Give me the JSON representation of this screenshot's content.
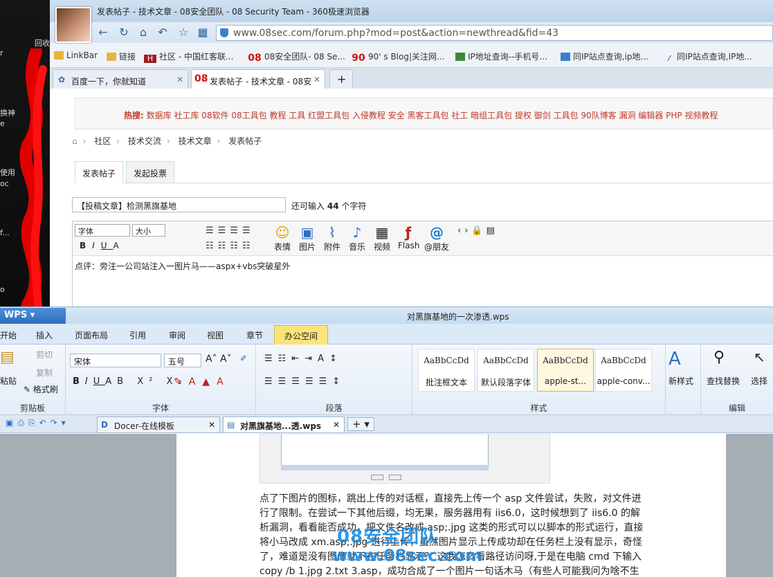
{
  "desktop": {
    "labels": [
      "回收",
      "r",
      "换神",
      "e",
      "使用",
      "oc",
      "f...",
      "o"
    ]
  },
  "browser": {
    "window_title": "发表帖子 - 技术文章 - 08安全团队 - 08 Security Team - 360极速浏览器",
    "url": "www.08sec.com/forum.php?mod=post&action=newthread&fid=43",
    "bookmarks": [
      "LinkBar",
      "链接",
      "社区 - 中国红客联...",
      "08安全团队- 08 Se...",
      "90' s Blog|关注网...",
      "IP地址查询--手机号...",
      "同IP站点查询,ip地...",
      "同IP站点查询,IP地..."
    ],
    "tabs": [
      {
        "label": "百度一下，你就知道"
      },
      {
        "label": "发表帖子 - 技术文章 - 08安"
      }
    ],
    "new_tab": "+",
    "hot_label": "热搜:",
    "hot_items": "数据库  社工库  08软件  08工具包  教程  工具  红盟工具包  入侵教程  安全  黑客工具包  社工  暗组工具包  提权  御剑  工具包  90队博客  漏洞  编辑器  PHP  视频教程",
    "breadcrumb": [
      "社区",
      "技术交流",
      "技术文章",
      "发表帖子"
    ],
    "post_tabs": [
      "发表帖子",
      "发起投票"
    ],
    "subject": "【投稿文章】检测黑旗基地",
    "count_prefix": "还可输入",
    "count_value": "44",
    "count_suffix": "个字符",
    "font_select": "字体",
    "size_select": "大小",
    "editor_icons": [
      "表情",
      "图片",
      "附件",
      "音乐",
      "视频",
      "Flash",
      "@朋友"
    ],
    "editor_text": "点评：旁注一公司站注入一图片马——aspx+vbs突破星外"
  },
  "wps": {
    "logo": "WPS",
    "doc_title": "对黑旗基地的一次渗透.wps",
    "menu": [
      "开始",
      "插入",
      "页面布局",
      "引用",
      "审阅",
      "视图",
      "章节",
      "办公空间"
    ],
    "clip": {
      "paste": "粘贴",
      "cut": "剪切",
      "copy": "复制",
      "format": "格式刷",
      "name": "剪贴板"
    },
    "font": {
      "family": "宋体",
      "size": "五号",
      "name": "字体"
    },
    "para_name": "段落",
    "styles": [
      {
        "sample": "AaBbCcDd",
        "name": "批注框文本"
      },
      {
        "sample": "AaBbCcDd",
        "name": "默认段落字体"
      },
      {
        "sample": "AaBbCcDd",
        "name": "apple-st..."
      },
      {
        "sample": "AaBbCcDd",
        "name": "apple-conv..."
      }
    ],
    "styles_name": "样式",
    "new_style": "新样式",
    "find": "查找替换",
    "select": "选择",
    "edit_name": "编辑",
    "doc_tabs": [
      "Docer-在线模板",
      "对黑旗基地...透.wps"
    ],
    "body": "点了下图片的图标，跳出上传的对话框，直接先上传一个 asp 文件尝试，失败，对文件进行了限制。在尝试一下其他后缀，均无果，服务器用有 iis6.0，这时候想到了 iis6.0 的解析漏洞，看看能否成功，把文件名改成 asp;.jpg 这类的形式可以以脚本的形式运行，直接将小马改成 xm.asp;.jpg 进行上传，虽然图片显示上传成功却在任务栏上没有显示，奇怪了，难道是没有图像就不在任务栏显示？ 这我怎么看路径访问呀,于是在电脑 cmd 下输入 copy /b 1.jpg 2.txt 3.asp，成功合成了一个图片一句话木马（有些人可能我问为啥不生成大马,",
    "watermark1": "08安全团队",
    "watermark2": "www.08sec.com"
  },
  "colors": {
    "accent": "#2c6fbe",
    "hot": "#c0392b",
    "office": "#fbe47a"
  }
}
